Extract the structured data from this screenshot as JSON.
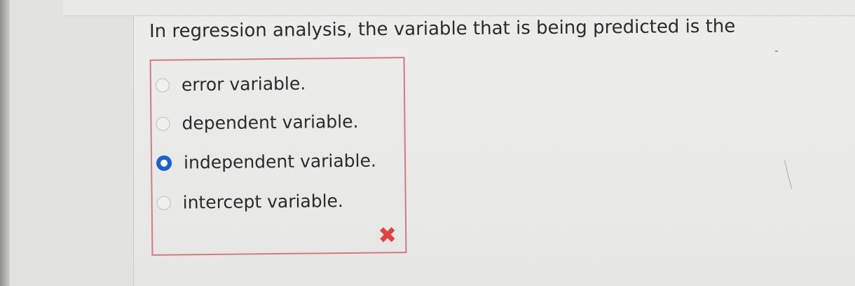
{
  "question": {
    "text": "In regression analysis, the variable that is being predicted is the"
  },
  "options": [
    {
      "label": "error variable.",
      "selected": false
    },
    {
      "label": "dependent variable.",
      "selected": false
    },
    {
      "label": "independent variable.",
      "selected": true
    },
    {
      "label": "intercept variable.",
      "selected": false
    }
  ],
  "result": {
    "status": "incorrect",
    "icon": "x-mark-icon",
    "mark": "✖",
    "color": "#e0453d"
  },
  "colors": {
    "selected_radio": "#1a63c9",
    "box_border": "#d27a80"
  }
}
